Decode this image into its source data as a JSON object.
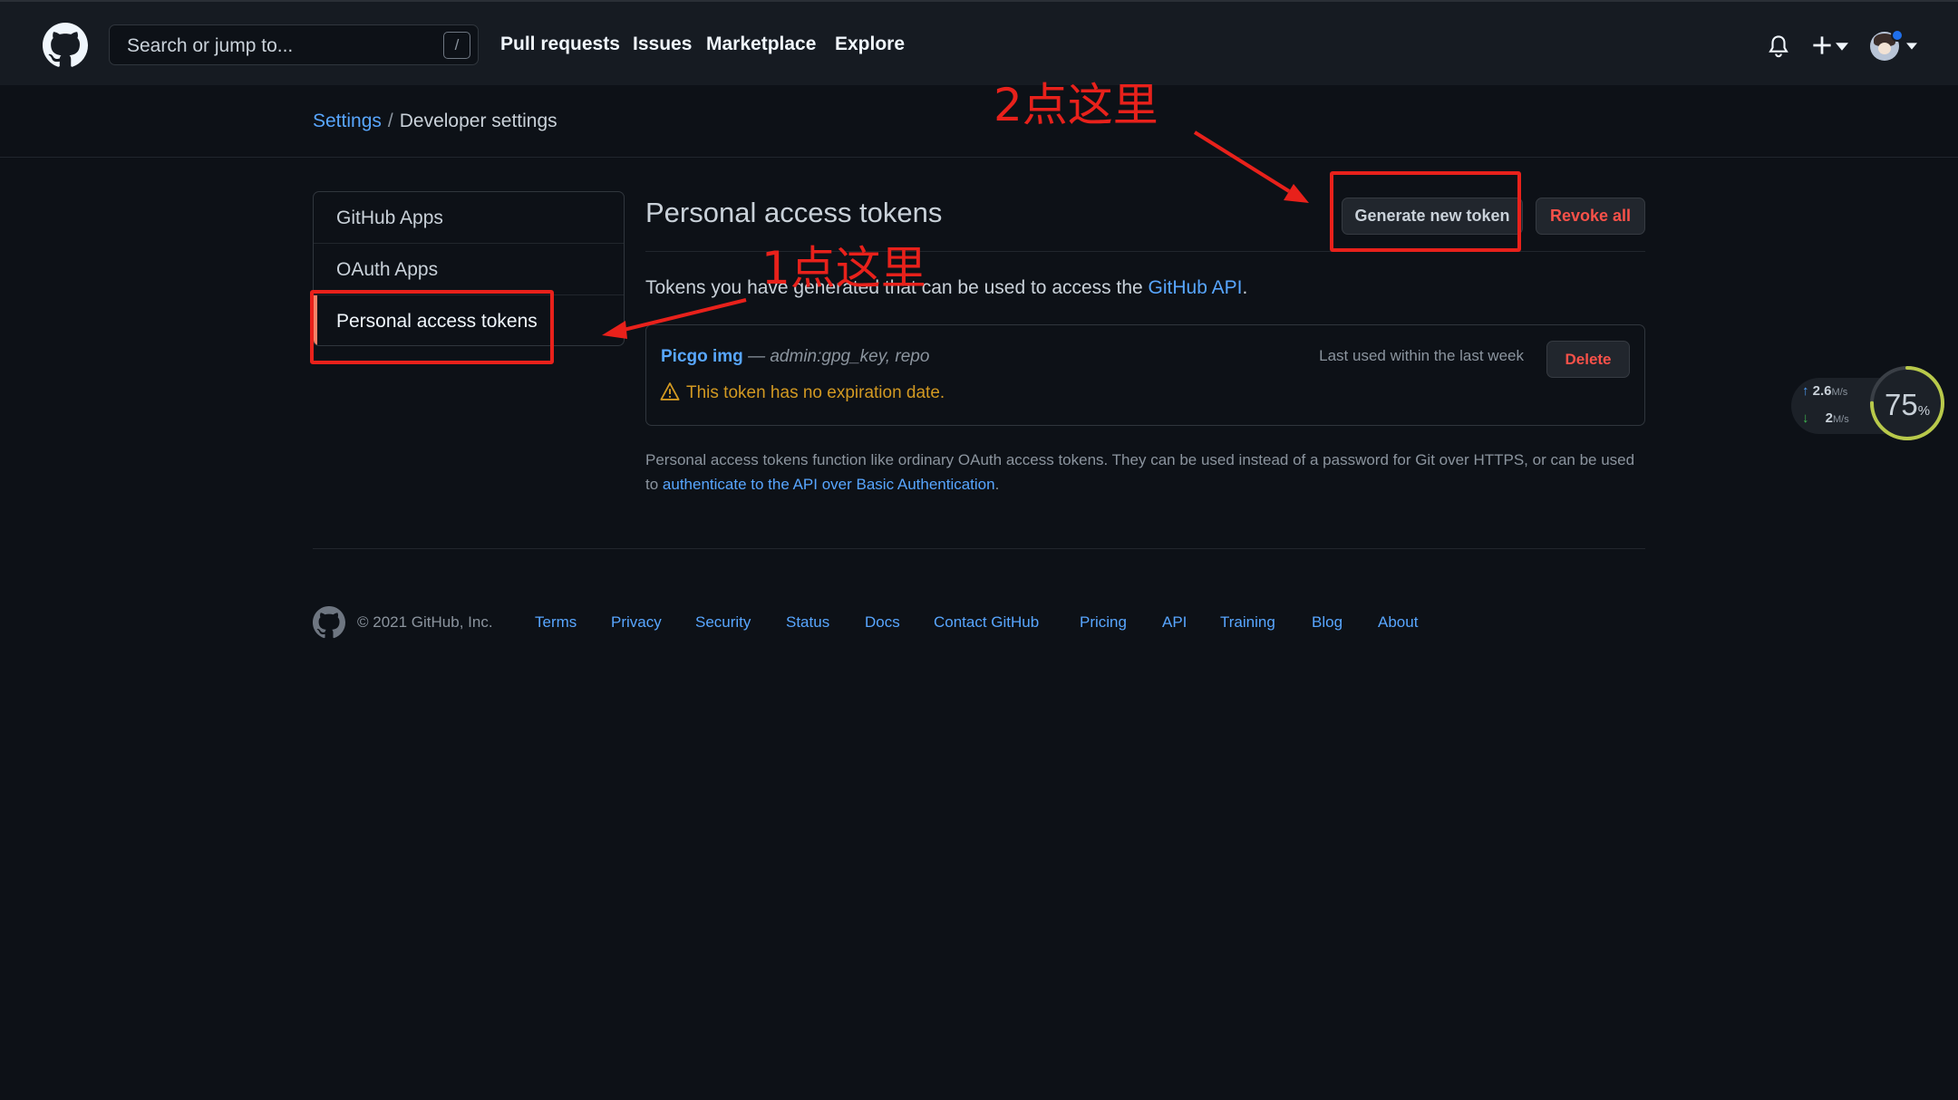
{
  "header": {
    "search_placeholder": "Search or jump to...",
    "search_shortcut": "/",
    "nav": [
      "Pull requests",
      "Issues",
      "Marketplace",
      "Explore"
    ],
    "icons": [
      "github-logo-icon",
      "bell-icon",
      "plus-icon",
      "chevron-down-icon",
      "avatar"
    ]
  },
  "breadcrumb": {
    "settings": "Settings",
    "separator": "/",
    "current": "Developer settings"
  },
  "sidebar": {
    "items": [
      {
        "label": "GitHub Apps"
      },
      {
        "label": "OAuth Apps"
      },
      {
        "label": "Personal access tokens"
      }
    ]
  },
  "main": {
    "title": "Personal access tokens",
    "generate_button": "Generate new token",
    "revoke_button": "Revoke all",
    "intro_before": "Tokens you have generated that can be used to access the ",
    "intro_link": "GitHub API",
    "intro_after": "."
  },
  "token": {
    "name": "Picgo img",
    "scopes": " — admin:gpg_key, repo",
    "warning": "This token has no expiration date.",
    "last_used": "Last used within the last week",
    "delete_button": "Delete"
  },
  "note": {
    "text": "Personal access tokens function like ordinary OAuth access tokens. They can be used instead of a password for Git over HTTPS, or can be used to ",
    "link": "authenticate to the API over Basic Authentication",
    "end": "."
  },
  "footer": {
    "copyright": "© 2021 GitHub, Inc.",
    "links": [
      "Terms",
      "Privacy",
      "Security",
      "Status",
      "Docs",
      "Contact GitHub",
      "Pricing",
      "API",
      "Training",
      "Blog",
      "About"
    ]
  },
  "speed_widget": {
    "upload": "2.6",
    "upload_unit": "M/s",
    "download": "2",
    "download_unit": "M/s",
    "percent": "75",
    "percent_unit": "%",
    "percent_value": 75
  },
  "annotations": {
    "step1": "1点这里",
    "step2": "2点这里"
  },
  "colors": {
    "background": "#0d1117",
    "header": "#161b22",
    "link": "#58a6ff",
    "danger": "#f85149",
    "warning": "#d29922",
    "annotation": "#e8211b"
  }
}
